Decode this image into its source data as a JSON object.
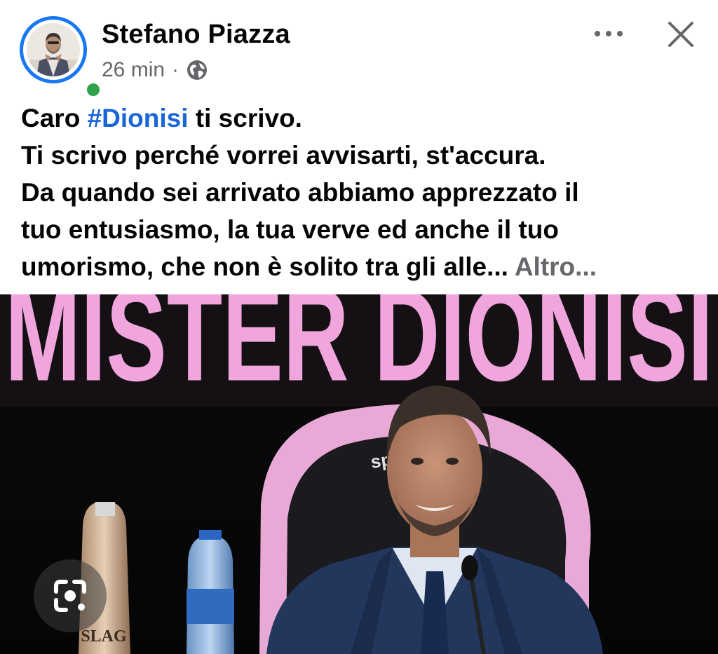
{
  "post": {
    "author": "Stefano Piazza",
    "time": "26 min",
    "separator": "·",
    "visibility_icon": "globe-icon",
    "more_icon": "more-horizontal-icon",
    "close_icon": "close-icon",
    "online": true
  },
  "text": {
    "line1_prefix": "Caro ",
    "hashtag": "#Dionisi",
    "line1_suffix": " ti scrivo.",
    "line2": "Ti scrivo perché vorrei avvisarti, st'accura.",
    "line3": "Da quando sei arrivato abbiamo apprezzato il",
    "line4": "tuo entusiasmo, la tua verve ed anche il tuo",
    "line5": "umorismo, che non è solito tra gli alle...",
    "see_more": "Altro..."
  },
  "photo": {
    "banner_text": "MISTER DIONISI",
    "bottle_label": "SLAG",
    "chair_brand": "sparco",
    "lens_icon": "visual-search-icon"
  },
  "colors": {
    "accent": "#1877f2",
    "hashtag": "#1a66d6",
    "online": "#31a24c",
    "secondary_text": "#65676b",
    "banner_pink": "#f0a6dc"
  }
}
